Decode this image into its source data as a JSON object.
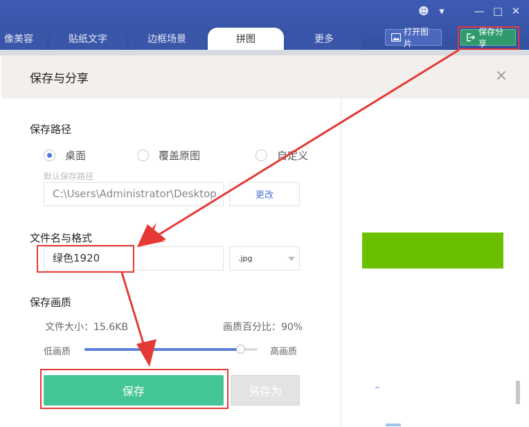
{
  "window": {
    "controls": [
      {
        "name": "feedback-icon",
        "glyph": "☻"
      },
      {
        "name": "menu-dropdown-icon",
        "glyph": "▾"
      },
      {
        "name": "minimize-icon",
        "glyph": "—"
      },
      {
        "name": "maximize-icon",
        "glyph": "□"
      },
      {
        "name": "close-window-icon",
        "glyph": "✕"
      }
    ]
  },
  "tabs": [
    {
      "label": "像美容",
      "active": false
    },
    {
      "label": "贴纸文字",
      "active": false
    },
    {
      "label": "边框场景",
      "active": false
    },
    {
      "label": "拼图",
      "active": true
    },
    {
      "label": "更多",
      "active": false
    }
  ],
  "header_buttons": {
    "open_image": "打开图片",
    "save_share": "保存分享"
  },
  "dialog": {
    "title": "保存与分享",
    "close_glyph": "×",
    "save_path": {
      "label": "保存路径",
      "options": [
        {
          "label": "桌面",
          "selected": true
        },
        {
          "label": "覆盖原图",
          "selected": false
        },
        {
          "label": "自定义",
          "selected": false
        }
      ],
      "hint": "默认保存路径",
      "path_value": "C:\\Users\\Administrator\\Desktop",
      "change_label": "更改"
    },
    "file": {
      "label": "文件名与格式",
      "name_value": "绿色1920",
      "extension": ".jpg"
    },
    "quality": {
      "label": "保存画质",
      "file_size": "文件大小：15.6KB",
      "quality_percent_text": "画质百分比：90%",
      "quality_value": 0.9,
      "low_label": "低画质",
      "high_label": "高画质"
    },
    "buttons": {
      "save": "保存",
      "save_as": "另存为"
    },
    "preview": {
      "color": "#6abf00"
    }
  },
  "colors": {
    "titlebar": "#3d5bb4",
    "accent_green": "#45c697",
    "annotation_red": "#e53935",
    "radio_blue": "#4d74d6"
  }
}
